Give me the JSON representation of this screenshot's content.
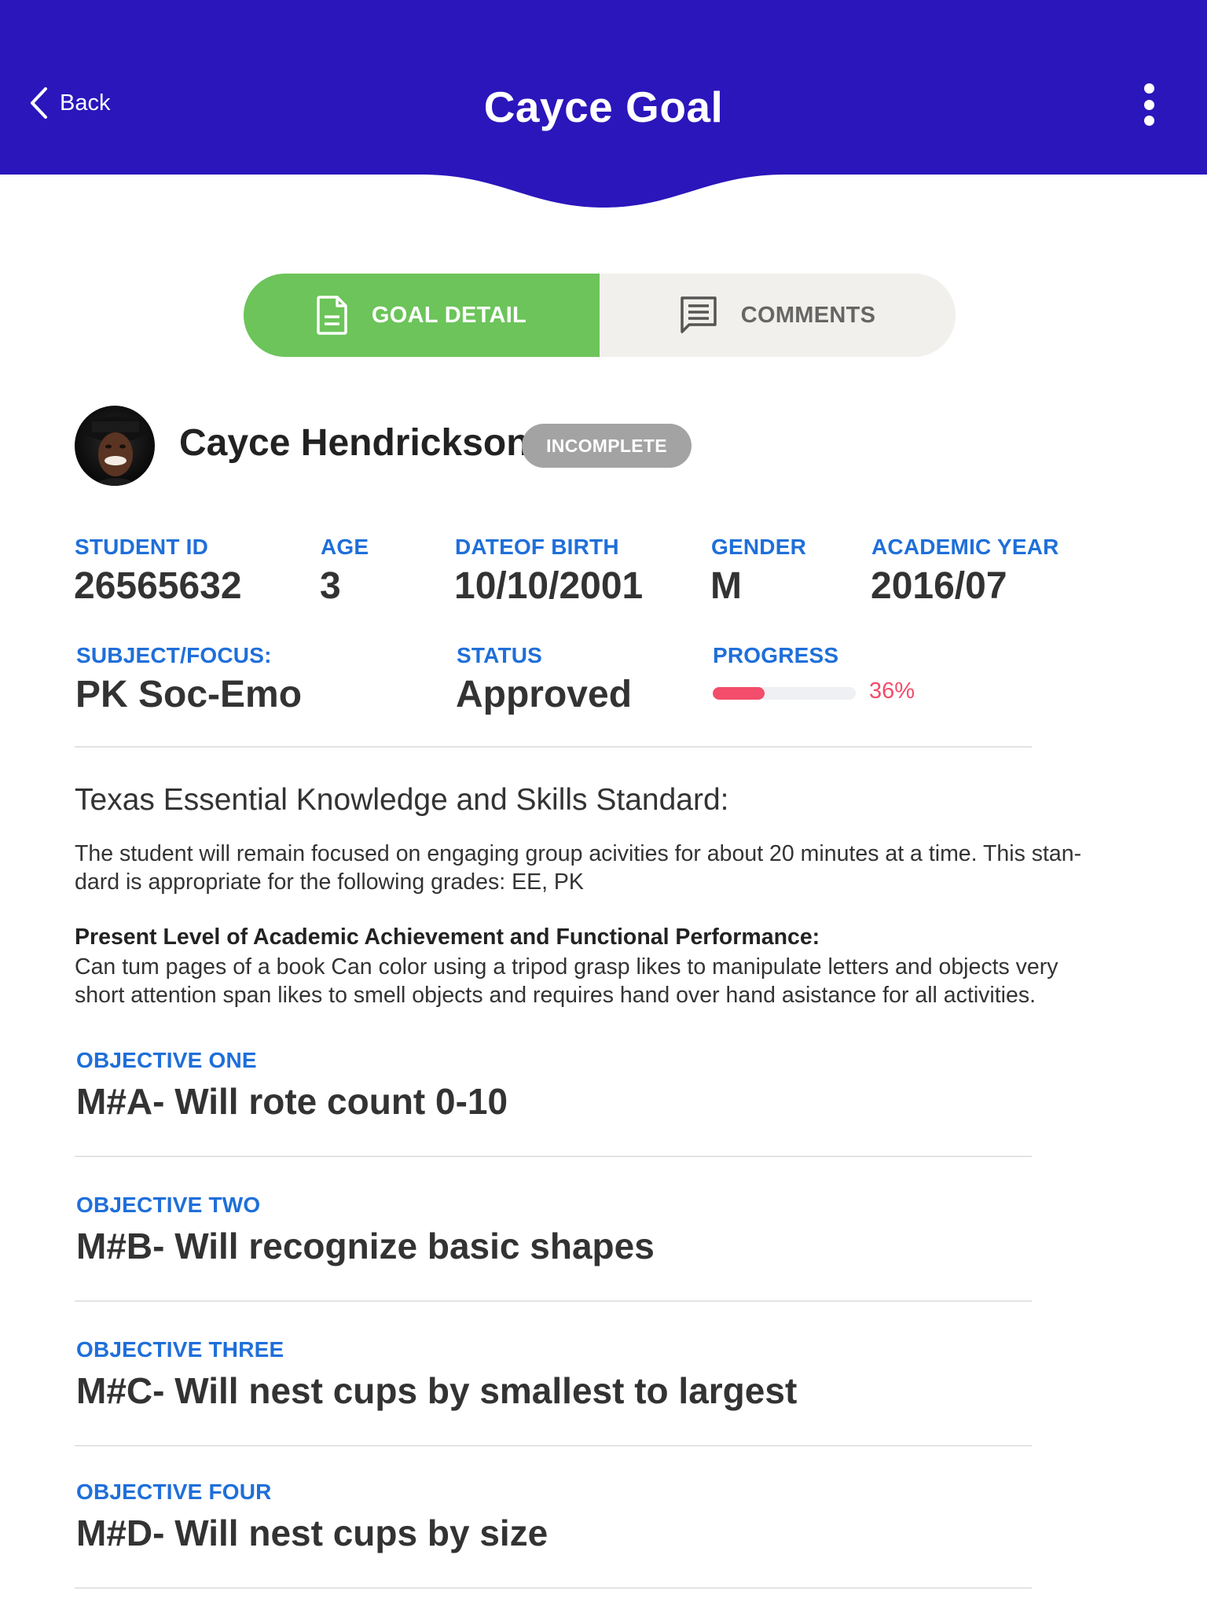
{
  "header": {
    "back_label": "Back",
    "title": "Cayce Goal",
    "background_color": "#2a16bb"
  },
  "tabs": [
    {
      "label": "GOAL DETAIL",
      "icon": "document-icon",
      "active": true,
      "color": "#6cc45a"
    },
    {
      "label": "COMMENTS",
      "icon": "comment-icon",
      "active": false
    }
  ],
  "student": {
    "name": "Cayce Hendrickson",
    "status_badge": "INCOMPLETE",
    "avatar": "student-photo"
  },
  "info": {
    "student_id_label": "STUDENT ID",
    "student_id": "26565632",
    "age_label": "AGE",
    "age": "3",
    "dob_label": "DATEOF BIRTH",
    "dob": "10/10/2001",
    "gender_label": "GENDER",
    "gender": "M",
    "academic_year_label": "ACADEMIC YEAR",
    "academic_year": "2016/07",
    "subject_label": "SUBJECT/FOCUS:",
    "subject": "PK Soc-Emo",
    "status_label": "STATUS",
    "status": "Approved",
    "progress_label": "PROGRESS",
    "progress_text": "36%",
    "progress_value": 0.36,
    "progress_color": "#f24d6a"
  },
  "standard": {
    "heading": "Texas Essential Knowledge and Skills Standard:",
    "body_line1": "The student will remain focused on engaging group acivities for about 20 minutes at a time. This stan-",
    "body_line2": "dard is appropriate for the following grades: EE, PK",
    "plaafp_heading": "Present Level of Academic Achievement and Functional Performance:",
    "plaafp_line1": "Can tum pages of a book Can color using a tripod grasp likes to manipulate letters and objects very",
    "plaafp_line2": "short attention span likes to smell objects and requires hand over hand asistance for all activities."
  },
  "objectives": [
    {
      "label": "OBJECTIVE ONE",
      "text": "M#A- Will rote count 0-10"
    },
    {
      "label": "OBJECTIVE TWO",
      "text": "M#B- Will recognize basic shapes"
    },
    {
      "label": "OBJECTIVE THREE",
      "text": "M#C- Will nest cups by smallest to largest"
    },
    {
      "label": "OBJECTIVE FOUR",
      "text": "M#D- Will nest cups by size"
    }
  ]
}
